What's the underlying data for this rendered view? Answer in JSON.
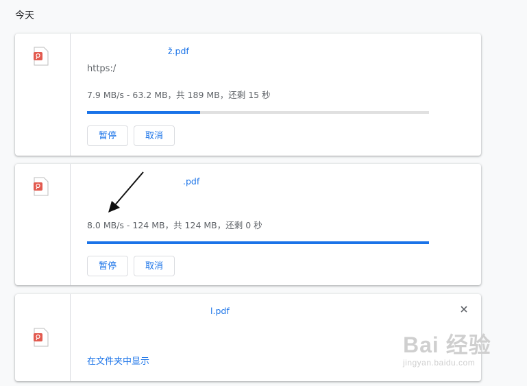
{
  "section": {
    "title": "今天"
  },
  "downloads": [
    {
      "file_name_visible": "ž.pdf",
      "url": "https:/",
      "status": "7.9 MB/s - 63.2 MB，共 189 MB，还剩 15 秒",
      "progress": 0.33,
      "pause_label": "暂停",
      "cancel_label": "取消",
      "icon": "pdf-file-icon"
    },
    {
      "file_name_visible": ".pdf",
      "status": "8.0 MB/s - 124 MB，共 124 MB，还剩 0 秒",
      "progress": 1.0,
      "pause_label": "暂停",
      "cancel_label": "取消",
      "icon": "pdf-file-icon"
    },
    {
      "file_name_visible": "l.pdf",
      "show_in_folder_label": "在文件夹中显示",
      "close_icon": "close-icon",
      "icon": "pdf-file-icon"
    }
  ],
  "watermark": {
    "brand": "Bai 经验",
    "sub": "jingyan.baidu.com"
  },
  "colors": {
    "accent": "#1a73e8",
    "pdf_red": "#e25a4f",
    "progress_track": "#e0e0e0"
  }
}
